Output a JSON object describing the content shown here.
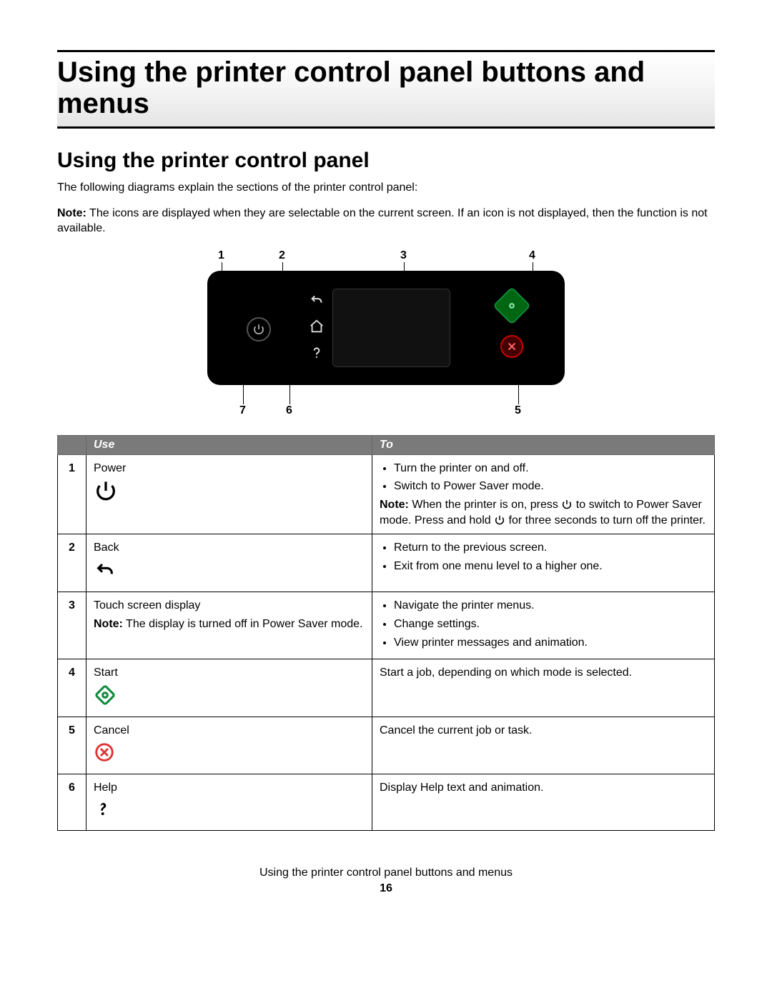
{
  "chapter_title": "Using the printer control panel buttons and menus",
  "section_title": "Using the printer control panel",
  "intro": "The following diagrams explain the sections of the printer control panel:",
  "note_label": "Note:",
  "note_body": " The icons are displayed when they are selectable on the current screen. If an icon is not displayed, then the function is not available.",
  "callouts": {
    "c1": "1",
    "c2": "2",
    "c3": "3",
    "c4": "4",
    "c5": "5",
    "c6": "6",
    "c7": "7"
  },
  "table": {
    "head_num": "",
    "head_use": "Use",
    "head_to": "To",
    "rows": {
      "r1": {
        "num": "1",
        "name": "Power",
        "to_b1": "Turn the printer on and off.",
        "to_b2": "Switch to Power Saver mode.",
        "to_note_label": "Note:",
        "to_note_a": " When the printer is on, press ",
        "to_note_b": " to switch to Power Saver mode. Press and hold ",
        "to_note_c": " for three seconds to turn off the printer."
      },
      "r2": {
        "num": "2",
        "name": "Back",
        "to_b1": "Return to the previous screen.",
        "to_b2": "Exit from one menu level to a higher one."
      },
      "r3": {
        "num": "3",
        "name": "Touch screen display",
        "use_note_label": "Note:",
        "use_note": " The display is turned off in Power Saver mode.",
        "to_b1": "Navigate the printer menus.",
        "to_b2": "Change settings.",
        "to_b3": "View printer messages and animation."
      },
      "r4": {
        "num": "4",
        "name": "Start",
        "to": "Start a job, depending on which mode is selected."
      },
      "r5": {
        "num": "5",
        "name": "Cancel",
        "to": "Cancel the current job or task."
      },
      "r6": {
        "num": "6",
        "name": "Help",
        "to": "Display Help text and animation."
      }
    }
  },
  "footer_title": "Using the printer control panel buttons and menus",
  "page_number": "16"
}
